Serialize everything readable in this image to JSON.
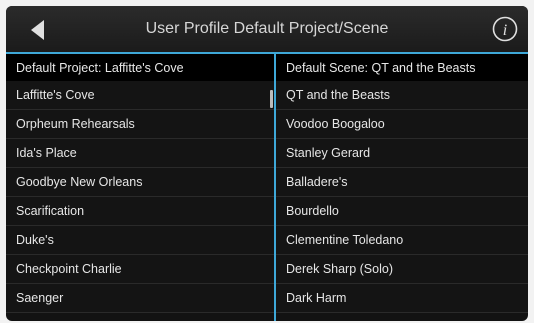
{
  "header": {
    "title": "User Profile Default Project/Scene",
    "back_icon": "back-triangle-icon",
    "info_icon": "info-icon"
  },
  "projects": {
    "header": "Default Project:  Laffitte's Cove",
    "items": [
      "Laffitte's Cove",
      "Orpheum Rehearsals",
      "Ida's Place",
      "Goodbye New Orleans",
      "Scarification",
      "Duke's",
      "Checkpoint Charlie",
      "Saenger"
    ]
  },
  "scenes": {
    "header": "Default Scene:  QT and the Beasts",
    "items": [
      "QT and the Beasts",
      "Voodoo Boogaloo",
      "Stanley Gerard",
      "Balladere's",
      "Bourdello",
      "Clementine Toledano",
      "Derek Sharp (Solo)",
      "Dark Harm"
    ]
  },
  "colors": {
    "accent": "#3ea8d8",
    "background": "#121212",
    "text": "#e6e6e6"
  }
}
